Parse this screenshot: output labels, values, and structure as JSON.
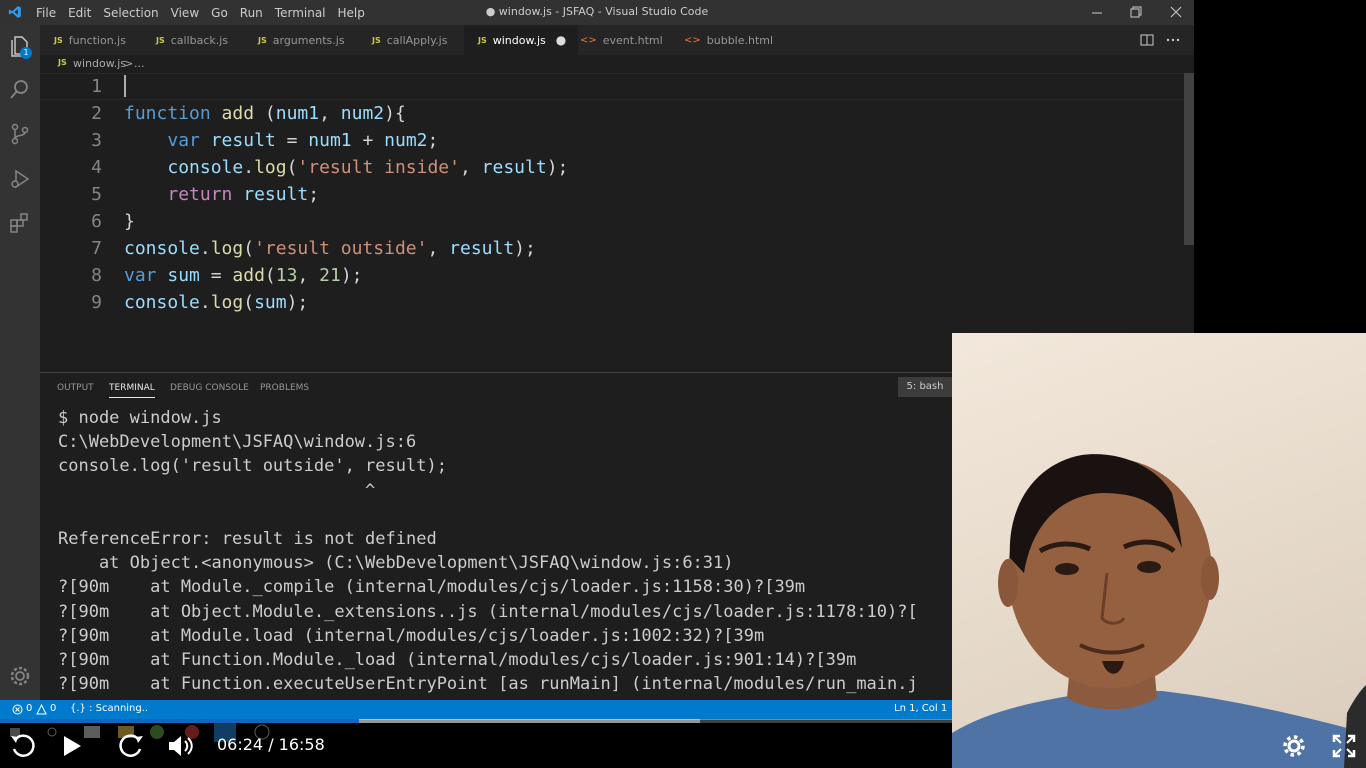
{
  "window": {
    "title": "● window.js - JSFAQ - Visual Studio Code",
    "menu": [
      "File",
      "Edit",
      "Selection",
      "View",
      "Go",
      "Run",
      "Terminal",
      "Help"
    ]
  },
  "tabs": [
    {
      "label": "function.js",
      "type": "js",
      "active": false
    },
    {
      "label": "callback.js",
      "type": "js",
      "active": false
    },
    {
      "label": "arguments.js",
      "type": "js",
      "active": false
    },
    {
      "label": "callApply.js",
      "type": "js",
      "active": false
    },
    {
      "label": "window.js",
      "type": "js",
      "active": true,
      "modified": true
    },
    {
      "label": "event.html",
      "type": "html",
      "active": false
    },
    {
      "label": "bubble.html",
      "type": "html",
      "active": false
    }
  ],
  "file_icon_labels": {
    "js": "JS",
    "html": "<>"
  },
  "breadcrumb": {
    "file": "window.js",
    "sep": ">",
    "rest": "..."
  },
  "editor": {
    "line_numbers": [
      "1",
      "2",
      "3",
      "4",
      "5",
      "6",
      "7",
      "8",
      "9"
    ]
  },
  "panel": {
    "tabs": [
      "OUTPUT",
      "TERMINAL",
      "DEBUG CONSOLE",
      "PROBLEMS"
    ],
    "active_tab": "TERMINAL",
    "terminal_selector": "5: bash"
  },
  "terminal_lines": [
    "$ node window.js",
    "C:\\WebDevelopment\\JSFAQ\\window.js:6",
    "console.log('result outside', result);",
    "                              ^",
    "",
    "ReferenceError: result is not defined",
    "    at Object.<anonymous> (C:\\WebDevelopment\\JSFAQ\\window.js:6:31)",
    "?[90m    at Module._compile (internal/modules/cjs/loader.js:1158:30)?[39m",
    "?[90m    at Object.Module._extensions..js (internal/modules/cjs/loader.js:1178:10)?[",
    "?[90m    at Module.load (internal/modules/cjs/loader.js:1002:32)?[39m",
    "?[90m    at Function.Module._load (internal/modules/cjs/loader.js:901:14)?[39m",
    "?[90m    at Function.executeUserEntryPoint [as runMain] (internal/modules/run_main.j"
  ],
  "statusbar": {
    "errors": "0",
    "warnings": "0",
    "scanning": "{.} : Scanning..",
    "position": "Ln 1, Col 1"
  },
  "badge": {
    "extensions_count": "1"
  },
  "player": {
    "time": "06:24 / 16:58",
    "progress_fraction": 0.377,
    "buffered_fraction": 0.735
  },
  "colors": {
    "accent": "#007acc",
    "editor_bg": "#1e1e1e",
    "progress": "#1565c0"
  }
}
